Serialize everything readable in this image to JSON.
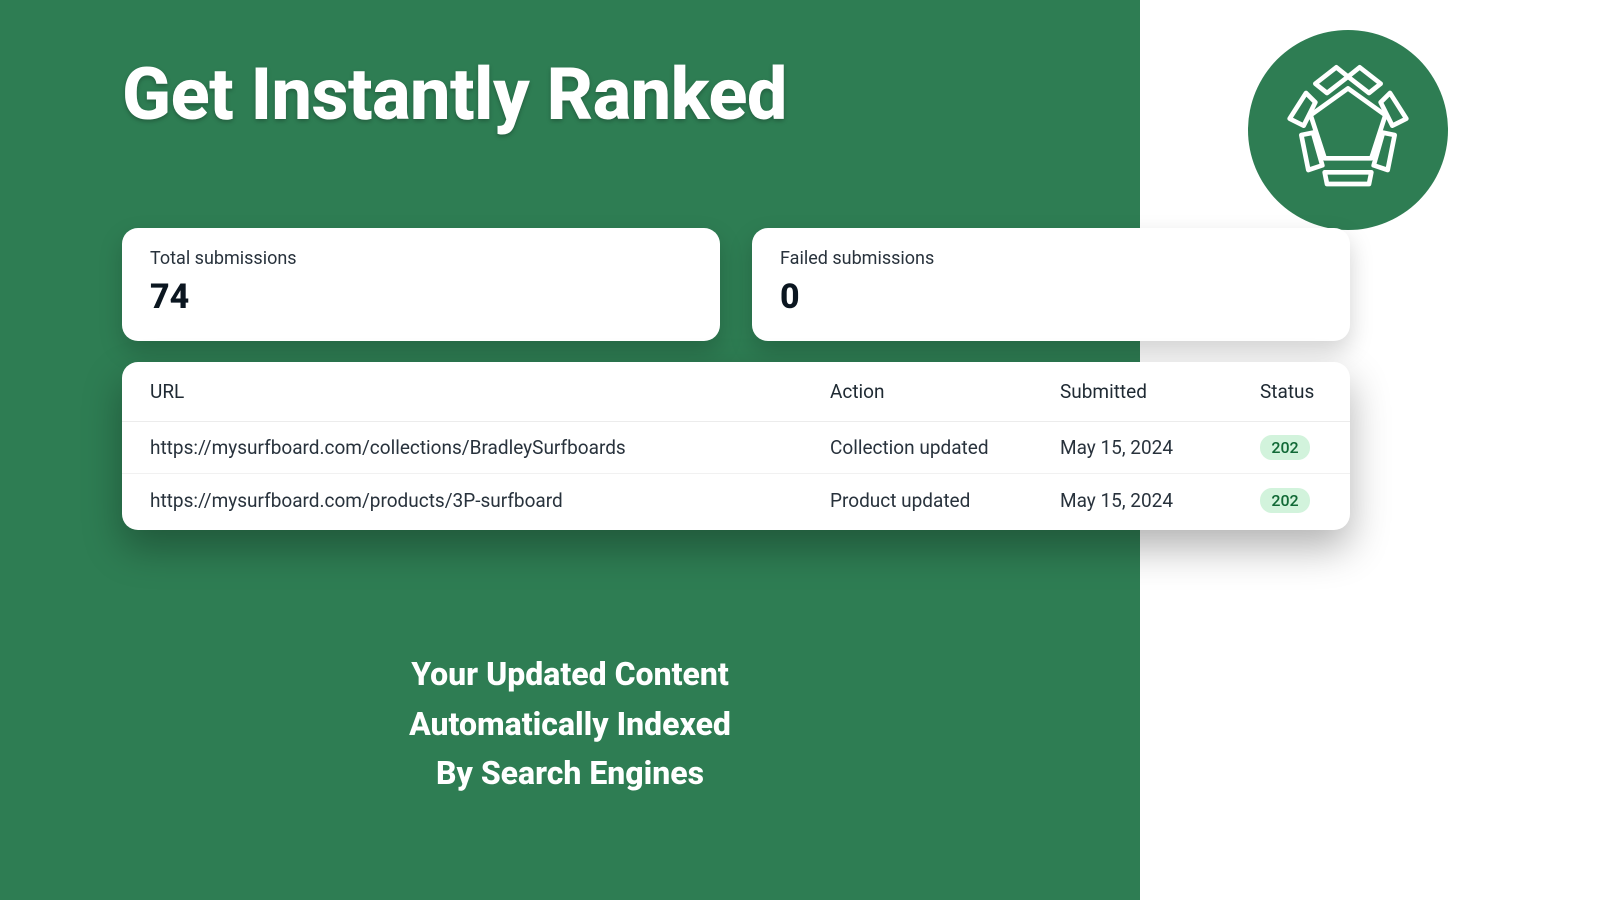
{
  "hero": {
    "title": "Get Instantly Ranked"
  },
  "metrics": {
    "total": {
      "label": "Total submissions",
      "value": "74"
    },
    "failed": {
      "label": "Failed submissions",
      "value": "0"
    }
  },
  "table": {
    "headers": {
      "url": "URL",
      "action": "Action",
      "submitted": "Submitted",
      "status": "Status"
    },
    "rows": [
      {
        "url": "https://mysurfboard.com/collections/BradleySurfboards",
        "action": "Collection updated",
        "submitted": "May 15, 2024",
        "status": "202"
      },
      {
        "url": "https://mysurfboard.com/products/3P-surfboard",
        "action": "Product updated",
        "submitted": "May 15, 2024",
        "status": "202"
      }
    ]
  },
  "tagline": {
    "line1": "Your Updated Content",
    "line2": "Automatically Indexed",
    "line3": "By Search Engines"
  },
  "colors": {
    "brand_green": "#2e7d53",
    "status_bg": "#d2f3dc",
    "status_fg": "#116936"
  }
}
